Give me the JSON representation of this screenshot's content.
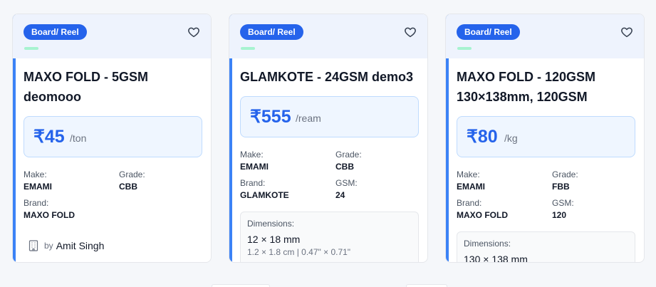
{
  "cards": [
    {
      "badge": "Board/ Reel",
      "title_line1": "MAXO FOLD - 5GSM",
      "title_line2": "deomooo",
      "price": "₹45",
      "unit": "/ton",
      "make_label": "Make:",
      "make": "EMAMI",
      "grade_label": "Grade:",
      "grade": "CBB",
      "brand_label": "Brand:",
      "brand": "MAXO FOLD",
      "seller_by": "by",
      "seller": "Amit Singh"
    },
    {
      "badge": "Board/ Reel",
      "title_line1": "GLAMKOTE - 24GSM demo3",
      "price": "₹555",
      "unit": "/ream",
      "make_label": "Make:",
      "make": "EMAMI",
      "grade_label": "Grade:",
      "grade": "CBB",
      "brand_label": "Brand:",
      "brand": "GLAMKOTE",
      "gsm_label": "GSM:",
      "gsm": "24",
      "dims_label": "Dimensions:",
      "dims": "12 × 18 mm",
      "dims_sub": "1.2 × 1.8 cm | 0.47\" × 0.71\""
    },
    {
      "badge": "Board/ Reel",
      "title_line1": "MAXO FOLD - 120GSM",
      "title_line2": "130×138mm, 120GSM",
      "price": "₹80",
      "unit": "/kg",
      "make_label": "Make:",
      "make": "EMAMI",
      "grade_label": "Grade:",
      "grade": "FBB",
      "brand_label": "Brand:",
      "brand": "MAXO FOLD",
      "gsm_label": "GSM:",
      "gsm": "120",
      "dims_label": "Dimensions:",
      "dims": "130 × 138 mm"
    }
  ],
  "colors": {
    "accent": "#3b82f6",
    "badge": "#2563eb",
    "price": "#2563eb"
  },
  "icons": {
    "favorite": "heart-icon",
    "seller": "building-icon"
  }
}
